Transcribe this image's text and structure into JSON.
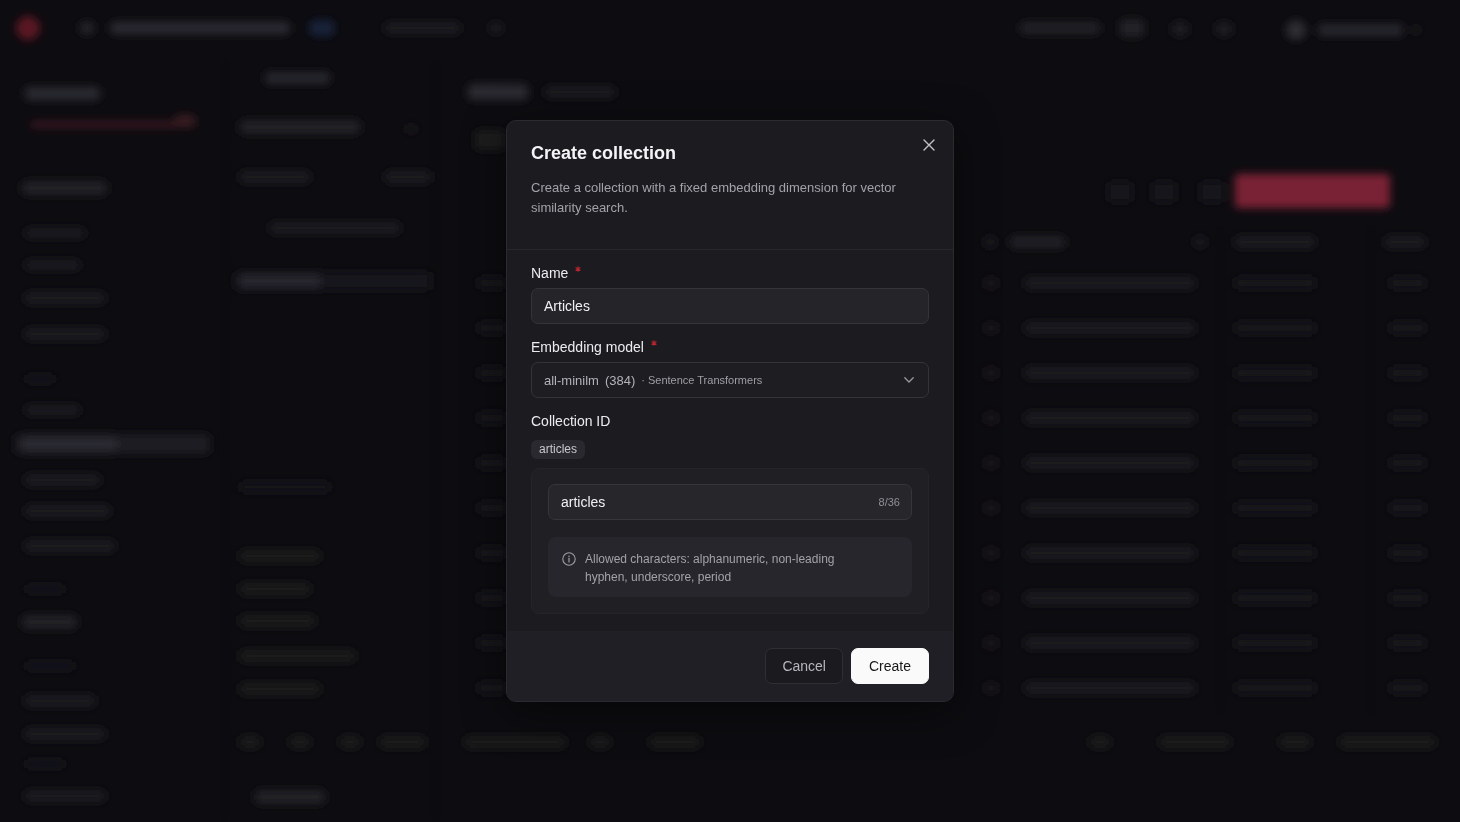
{
  "dialog": {
    "title": "Create collection",
    "description": "Create a collection with a fixed embedding dimension for vector similarity search.",
    "fields": [
      {
        "kind": "text",
        "label": "Name",
        "required": true,
        "value": "Articles"
      },
      {
        "kind": "select",
        "label": "Embedding model",
        "required": true,
        "value": "all-minilm",
        "dimension": "(384)",
        "provider": "· Sentence Transformers"
      },
      {
        "kind": "slug",
        "label": "Collection ID",
        "preview": "articles",
        "value": "articles",
        "counter": "8/36",
        "hint": "Allowed characters: alphanumeric, non-leading hyphen, underscore, period"
      }
    ],
    "buttons": [
      {
        "kind": "outline",
        "label": "Cancel"
      },
      {
        "kind": "solid",
        "label": "Create"
      }
    ]
  }
}
